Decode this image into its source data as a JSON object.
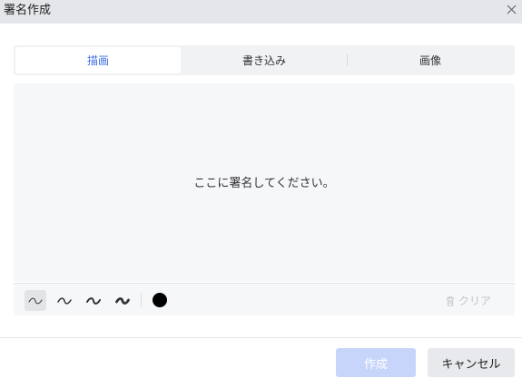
{
  "dialog": {
    "title": "署名作成",
    "close_icon": "close-icon"
  },
  "tabs": [
    {
      "label": "描画",
      "active": true
    },
    {
      "label": "書き込み",
      "active": false
    },
    {
      "label": "画像",
      "active": false
    }
  ],
  "canvas": {
    "placeholder": "ここに署名してください。"
  },
  "toolbar": {
    "strokes": [
      {
        "icon": "stroke-thin-icon",
        "active": true
      },
      {
        "icon": "stroke-medium-icon",
        "active": false
      },
      {
        "icon": "stroke-thick-icon",
        "active": false
      },
      {
        "icon": "stroke-extra-thick-icon",
        "active": false
      }
    ],
    "color": "#000000",
    "clear_label": "クリア",
    "clear_icon": "trash-icon"
  },
  "footer": {
    "create_label": "作成",
    "cancel_label": "キャンセル"
  },
  "colors": {
    "accent": "#3d6fe0",
    "primary_disabled": "#c8d5fb",
    "titlebar_bg": "#e4e6ea"
  }
}
